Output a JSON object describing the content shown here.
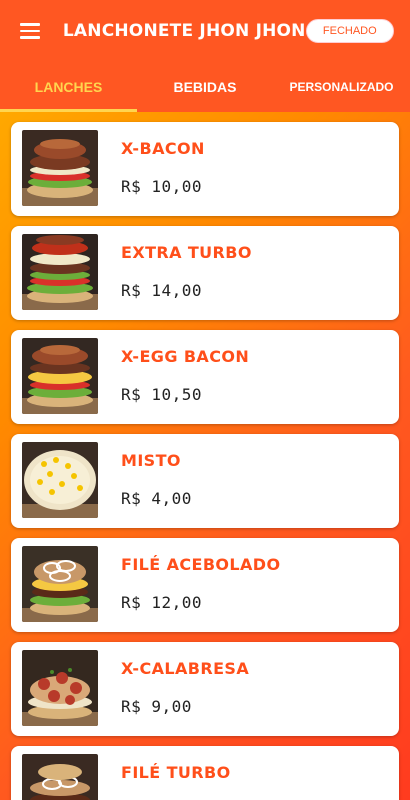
{
  "header": {
    "menu_icon": "hamburger-menu-icon",
    "title": "LANCHONETE JHON JHON",
    "status": "FECHADO"
  },
  "tabs": [
    {
      "label": "LANCHES",
      "active": true
    },
    {
      "label": "BEBIDAS",
      "active": false
    },
    {
      "label": "PERSONALIZADO",
      "active": false
    }
  ],
  "colors": {
    "primary": "#ff5722",
    "accent": "#ffd54f",
    "item_name": "#ff4f1a"
  },
  "items": [
    {
      "name": "X-BACON",
      "price": "R$ 10,00"
    },
    {
      "name": "EXTRA TURBO",
      "price": "R$ 14,00"
    },
    {
      "name": "X-EGG BACON",
      "price": "R$ 10,50"
    },
    {
      "name": "MISTO",
      "price": "R$ 4,00"
    },
    {
      "name": "FILÉ ACEBOLADO",
      "price": "R$ 12,00"
    },
    {
      "name": "X-CALABRESA",
      "price": "R$ 9,00"
    },
    {
      "name": "FILÉ TURBO",
      "price": ""
    }
  ]
}
